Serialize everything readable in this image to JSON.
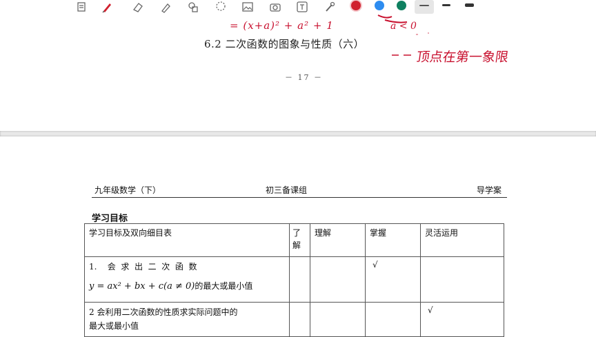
{
  "toolbar": {
    "tools": [
      "file-icon",
      "pen-icon",
      "eraser-icon",
      "highlighter-icon",
      "shapes-icon",
      "lasso-icon",
      "image-icon",
      "camera-icon",
      "text-icon",
      "laser-pointer-icon"
    ],
    "colors": [
      "#d0202e",
      "#2d8cf0",
      "#0f8060"
    ],
    "stroke_widths": [
      "thin",
      "medium",
      "thick"
    ]
  },
  "page1": {
    "section_title": "6.2  二次函数的图象与性质（六）",
    "page_number": "－ 17 －",
    "handwriting": {
      "formula": "= (x+a)² + a² + 1",
      "condition": "a < 0",
      "note": "顶点在第一象限",
      "color": "#c8102e"
    }
  },
  "page2": {
    "header": {
      "left": "九年级数学（下）",
      "middle": "初三备课组",
      "right": "导学案"
    },
    "goal_heading": "学习目标",
    "table": {
      "headers": [
        "学习目标及双向细目表",
        "了解",
        "理解",
        "掌握",
        "灵活运用"
      ],
      "rows": [
        {
          "goal_prefix": "1.    会  求  出  二  次  函  数",
          "formula": "y = ax² + bx + c(a ≠ 0)",
          "goal_suffix": "的最大或最小值",
          "marks": [
            "",
            "",
            "√",
            ""
          ]
        },
        {
          "goal_line1": "2  会利用二次函数的性质求实际问题中的",
          "goal_line2": "最大或最小值",
          "marks": [
            "",
            "",
            "",
            "√"
          ]
        }
      ]
    }
  }
}
